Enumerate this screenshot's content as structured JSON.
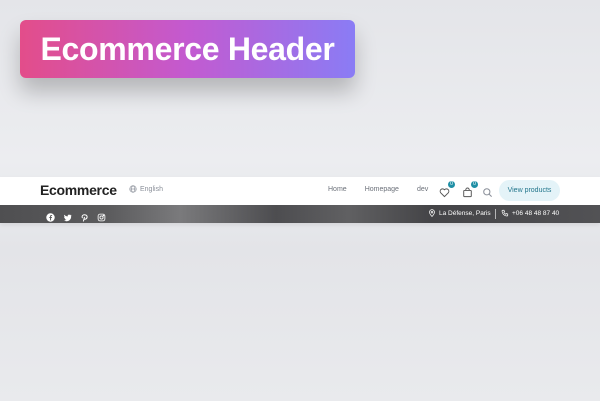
{
  "banner": {
    "title": "Ecommerce Header"
  },
  "header": {
    "logo": "Ecommerce",
    "language": "English",
    "menu": [
      "Home",
      "Homepage",
      "dev"
    ],
    "wishlist_count": "0",
    "cart_count": "0",
    "cta_label": "View products"
  },
  "topbar": {
    "social_icons": [
      "facebook-icon",
      "twitter-icon",
      "pinterest-icon",
      "instagram-icon"
    ],
    "location": "La Défense, Paris",
    "phone": "+06 48 48 87 40"
  },
  "colors": {
    "accent": "#1f8fa5",
    "cta_bg": "#e4f3f8",
    "cta_text": "#22768c",
    "banner_gradient": [
      "#e34d8a",
      "#c35ad0",
      "#8a7cf5"
    ]
  }
}
